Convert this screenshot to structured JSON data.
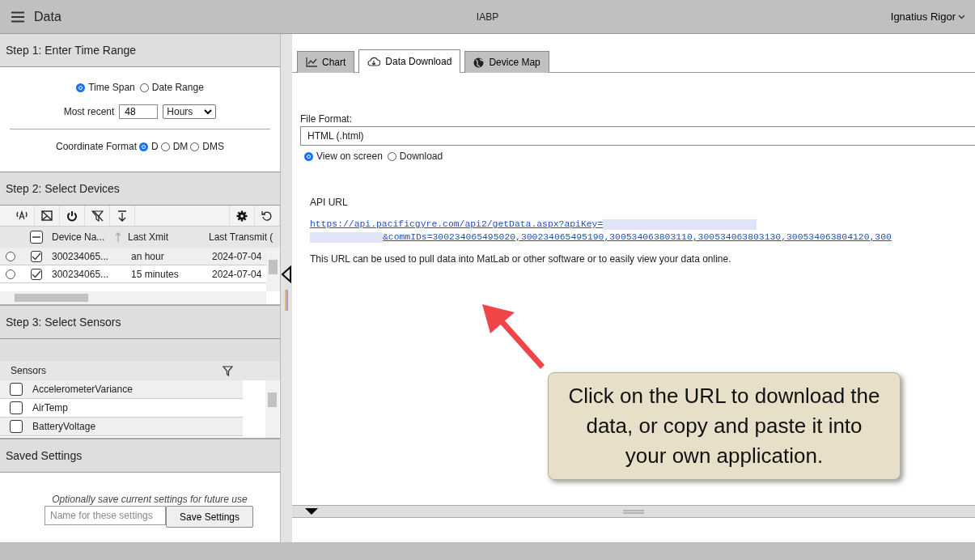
{
  "header": {
    "title": "Data",
    "center": "IABP",
    "user": "Ignatius Rigor"
  },
  "step1": {
    "title": "Step 1: Enter Time Range",
    "range_modes": [
      {
        "label": "Time Span",
        "selected": true
      },
      {
        "label": "Date Range",
        "selected": false
      }
    ],
    "recent_label": "Most recent",
    "recent_value": "48",
    "unit": "Hours",
    "coord_label": "Coordinate Format",
    "coord_options": [
      {
        "label": "D",
        "selected": true
      },
      {
        "label": "DM",
        "selected": false
      },
      {
        "label": "DMS",
        "selected": false
      }
    ]
  },
  "step2": {
    "title": "Step 2: Select Devices",
    "select_all": {
      "partial": true
    },
    "columns": [
      "Device Na...",
      "Last Xmit",
      "Last Transmit ("
    ],
    "rows": [
      {
        "name": "300234065...",
        "xmit": "an hour",
        "transmit": "2024-07-04",
        "selected": false,
        "checked": true
      },
      {
        "name": "300234065...",
        "xmit": "15 minutes",
        "transmit": "2024-07-04",
        "selected": false,
        "checked": true
      }
    ]
  },
  "step3": {
    "title": "Step 3: Select Sensors",
    "column": "Sensors",
    "sensors": [
      {
        "name": "AccelerometerVariance",
        "checked": false
      },
      {
        "name": "AirTemp",
        "checked": false
      },
      {
        "name": "BatteryVoltage",
        "checked": false
      }
    ]
  },
  "saved": {
    "title": "Saved Settings",
    "hint": "Optionally save current settings for future use",
    "placeholder": "Name for these settings",
    "button": "Save Settings"
  },
  "tabs": [
    {
      "label": "Chart",
      "selected": false
    },
    {
      "label": "Data Download",
      "selected": true
    },
    {
      "label": "Device Map",
      "selected": false
    }
  ],
  "download": {
    "format_label": "File Format:",
    "format": "HTML (.html)",
    "outputs": [
      {
        "label": "View on screen",
        "selected": true
      },
      {
        "label": "Download",
        "selected": false
      }
    ],
    "api_label": "API URL",
    "url_line1": "https://api.pacificgyre.com/api2/getData.aspx?apiKey=",
    "url_line2": "&commIDs=300234065495020,300234065495190,300534063803110,300534063803130,300534063804120,300",
    "note": "This URL can be used to pull data into MatLab or other software or to easily view your data online."
  },
  "callout": "Click on the URL to download the data, or copy and paste it into your own application."
}
